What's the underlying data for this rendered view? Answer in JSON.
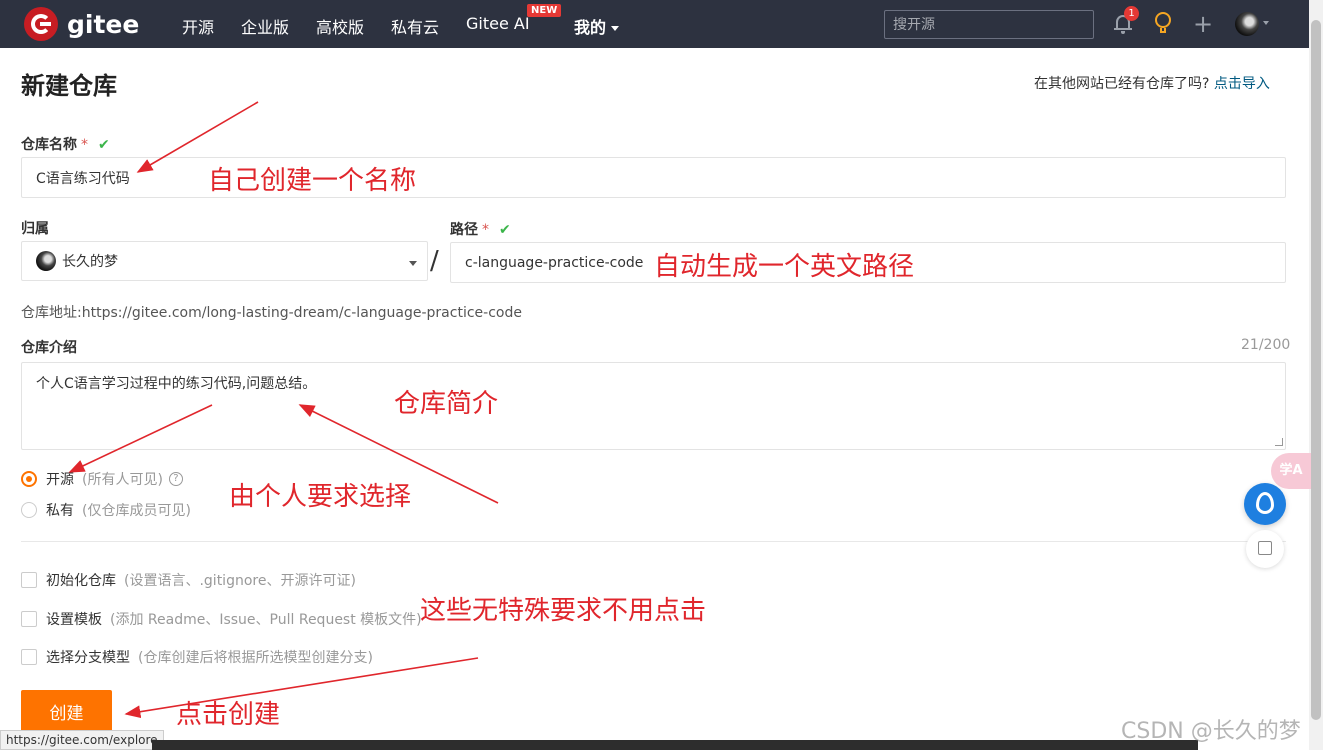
{
  "nav": {
    "logo_text": "gitee",
    "items": [
      "开源",
      "企业版",
      "高校版",
      "私有云",
      "Gitee AI",
      "我的"
    ],
    "new_tag": "NEW",
    "search_placeholder": "搜开源",
    "notification_count": "1"
  },
  "page": {
    "title": "新建仓库",
    "import_prompt": "在其他网站已经有仓库了吗?",
    "import_link": "点击导入"
  },
  "form": {
    "name_label": "仓库名称",
    "required_mark": "*",
    "check_mark": "✔",
    "name_value": "C语言练习代码",
    "owner_label": "归属",
    "owner_value": "长久的梦",
    "slash": "/",
    "path_label": "路径",
    "path_value": "c-language-practice-code",
    "address_label": "仓库地址:",
    "address_value": "https://gitee.com/long-lasting-dream/c-language-practice-code",
    "desc_label": "仓库介绍",
    "desc_counter": "21/200",
    "desc_value": "个人C语言学习过程中的练习代码,问题总结。",
    "visibility": [
      {
        "label": "开源",
        "hint": "(所有人可见)",
        "selected": true
      },
      {
        "label": "私有",
        "hint": "(仅仓库成员可见)",
        "selected": false
      }
    ],
    "options": [
      {
        "label": "初始化仓库",
        "hint": "(设置语言、.gitignore、开源许可证)"
      },
      {
        "label": "设置模板",
        "hint": "(添加 Readme、Issue、Pull Request 模板文件)"
      },
      {
        "label": "选择分支模型",
        "hint": "(仓库创建后将根据所选模型创建分支)"
      }
    ],
    "create_button": "创建"
  },
  "float": {
    "translate": "学A"
  },
  "status_url": "https://gitee.com/explore",
  "annotations": {
    "name": "自己创建一个名称",
    "path": "自动生成一个英文路径",
    "desc": "仓库简介",
    "visibility": "由个人要求选择",
    "options": "这些无特殊要求不用点击",
    "create": "点击创建"
  },
  "watermark": "CSDN @长久的梦",
  "colors": {
    "nav_bg": "#2d3240",
    "brand_red": "#c71d23",
    "accent_orange": "#fe7300",
    "annotation_red": "#e0262c",
    "link": "#005980",
    "check_green": "#3bb54a"
  }
}
